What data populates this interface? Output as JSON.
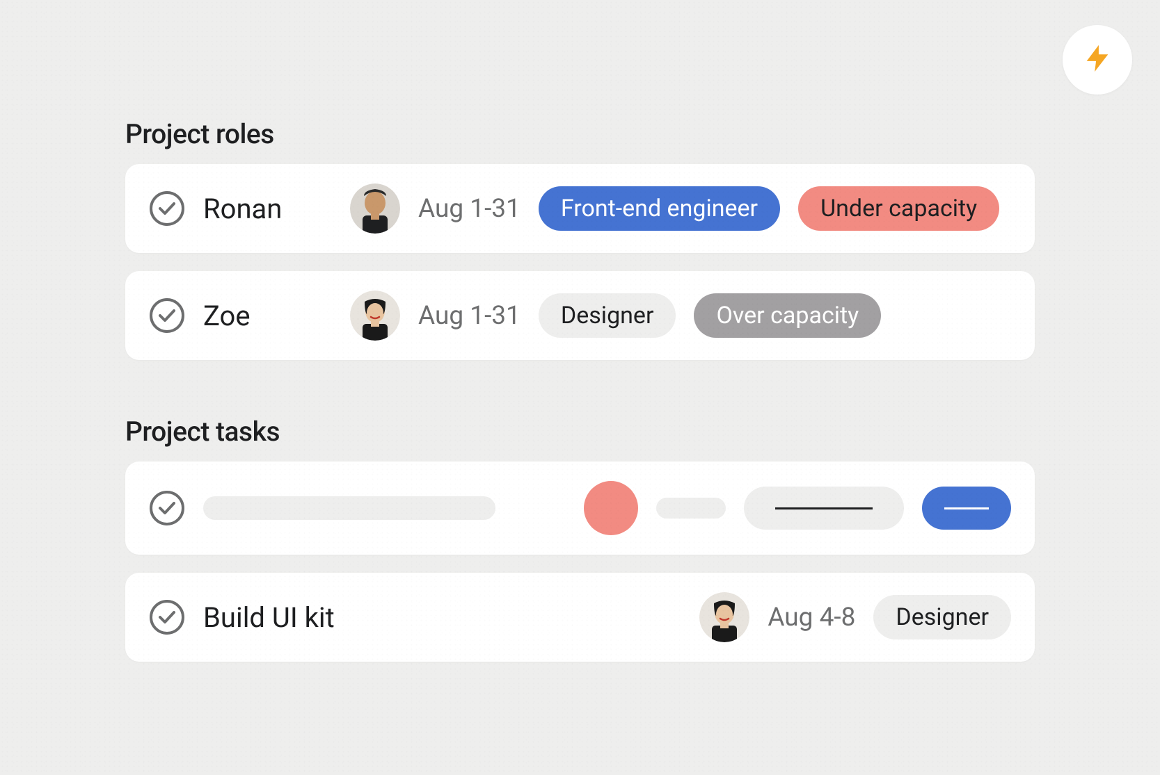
{
  "fab": {
    "icon": "lightning-icon"
  },
  "sections": {
    "roles": {
      "title": "Project roles",
      "items": [
        {
          "name": "Ronan",
          "dates": "Aug 1-31",
          "role": {
            "label": "Front-end engineer",
            "style": "blue"
          },
          "capacity": {
            "label": "Under capacity",
            "style": "salmon"
          },
          "avatar": "ronan"
        },
        {
          "name": "Zoe",
          "dates": "Aug 1-31",
          "role": {
            "label": "Designer",
            "style": "light"
          },
          "capacity": {
            "label": "Over capacity",
            "style": "gray"
          },
          "avatar": "zoe"
        }
      ]
    },
    "tasks": {
      "title": "Project tasks",
      "items": [
        {
          "skeleton": true
        },
        {
          "name": "Build UI kit",
          "dates": "Aug 4-8",
          "tag": {
            "label": "Designer",
            "style": "light"
          },
          "avatar": "zoe"
        }
      ]
    }
  },
  "colors": {
    "blue": "#4573d2",
    "salmon": "#f28b82",
    "gray": "#a2a0a2",
    "light": "#eeeeed"
  }
}
